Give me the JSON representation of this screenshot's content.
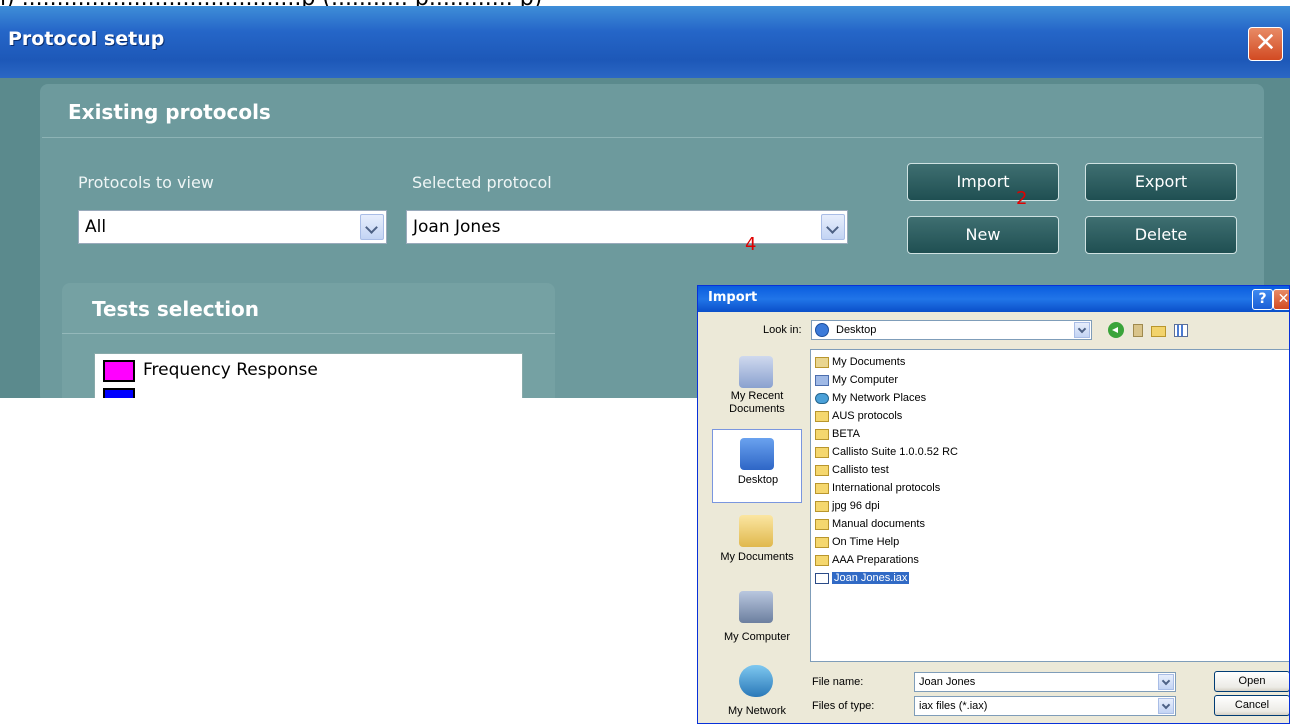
{
  "caption": "ı) ........................................p (........... p............ p)",
  "main_window": {
    "title": "Protocol setup",
    "close_glyph": "✕"
  },
  "existing_protocols": {
    "heading": "Existing protocols",
    "protocols_to_view_label": "Protocols to view",
    "protocols_to_view_value": "All",
    "selected_protocol_label": "Selected protocol",
    "selected_protocol_value": "Joan Jones",
    "buttons": {
      "import": "Import",
      "export": "Export",
      "new": "New",
      "delete": "Delete"
    }
  },
  "annotations": {
    "num_2": "2",
    "num_4": "4",
    "color": "#e00000"
  },
  "tests_selection": {
    "heading": "Tests selection",
    "items": [
      {
        "label": "Frequency Response",
        "swatch": "#ff00ff"
      },
      {
        "label": "...",
        "swatch": "#0000ff"
      }
    ]
  },
  "import_dialog": {
    "title": "Import",
    "help_glyph": "?",
    "close_glyph": "✕",
    "look_in_label": "Look in:",
    "look_in_value": "Desktop",
    "places": [
      "My Recent Documents",
      "Desktop",
      "My Documents",
      "My Computer",
      "My Network"
    ],
    "files": [
      {
        "name": "My Documents",
        "kind": "doc"
      },
      {
        "name": "My Computer",
        "kind": "comp"
      },
      {
        "name": "My Network Places",
        "kind": "net"
      },
      {
        "name": "AUS protocols",
        "kind": "folder"
      },
      {
        "name": "BETA",
        "kind": "folder"
      },
      {
        "name": "Callisto Suite 1.0.0.52 RC",
        "kind": "folder"
      },
      {
        "name": "Callisto test",
        "kind": "folder"
      },
      {
        "name": "International protocols",
        "kind": "folder"
      },
      {
        "name": "jpg 96 dpi",
        "kind": "folder"
      },
      {
        "name": "Manual documents",
        "kind": "folder"
      },
      {
        "name": "On Time Help",
        "kind": "folder"
      },
      {
        "name": "AAA Preparations",
        "kind": "folder"
      },
      {
        "name": "Joan Jones.iax",
        "kind": "iax",
        "selected": true
      }
    ],
    "file_name_label": "File name:",
    "file_name_value": "Joan Jones",
    "files_of_type_label": "Files of type:",
    "files_of_type_value": "iax files (*.iax)",
    "open_button": "Open",
    "cancel_button": "Cancel"
  }
}
